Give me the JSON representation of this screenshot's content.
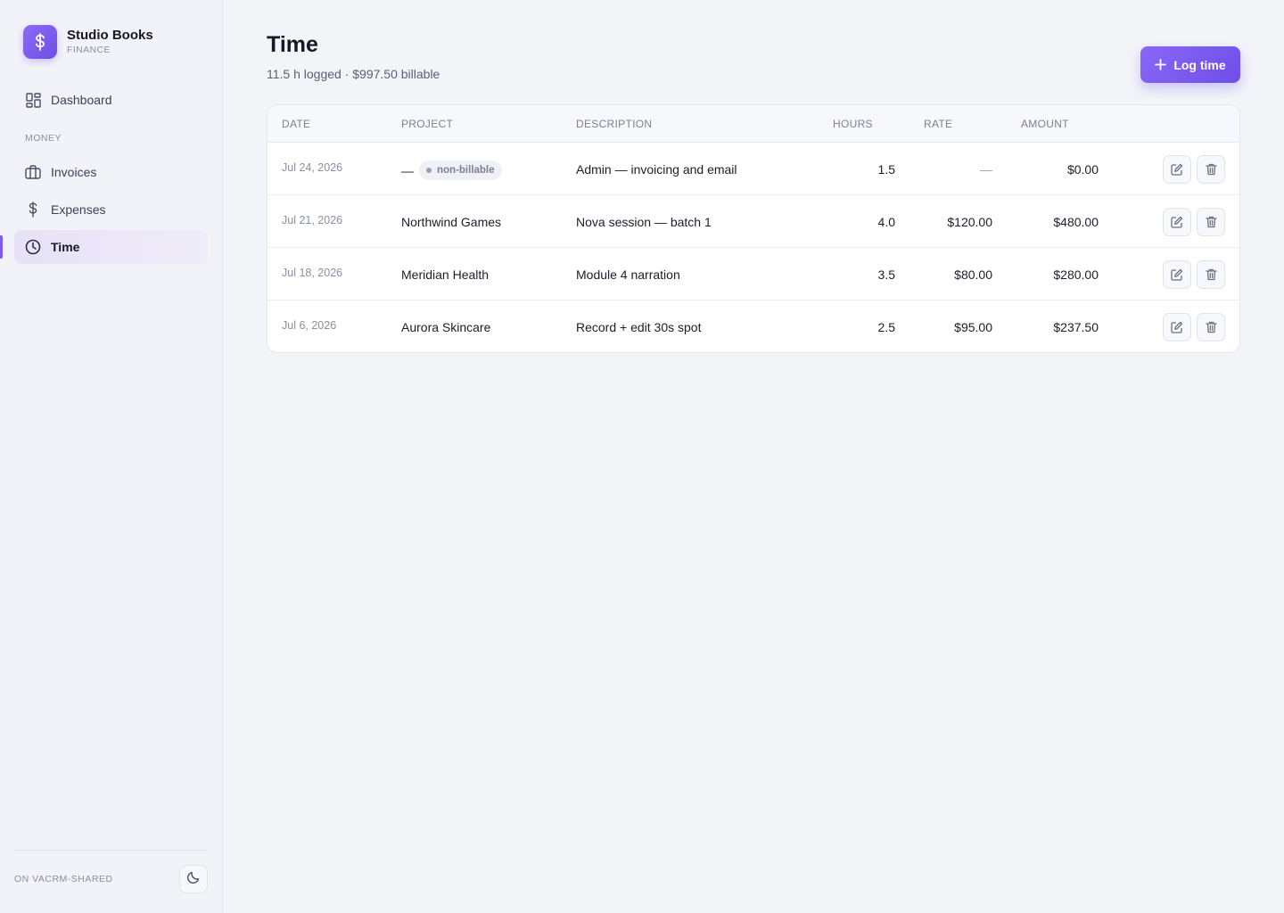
{
  "brand": {
    "name": "Studio Books",
    "subtitle": "FINANCE",
    "logo_icon": "dollar-icon",
    "accent": "#7a5af0"
  },
  "sidebar": {
    "items": [
      {
        "label": "Dashboard",
        "icon": "dashboard-icon"
      },
      {
        "label": "Invoices",
        "icon": "briefcase-icon"
      },
      {
        "label": "Expenses",
        "icon": "dollar-icon"
      },
      {
        "label": "Time",
        "icon": "clock-icon",
        "active": true
      }
    ],
    "section_money": "MONEY",
    "footer_label": "ON VACRM-SHARED",
    "theme_icon": "moon-icon"
  },
  "page": {
    "title": "Time",
    "subtitle": "11.5 h logged · $997.50 billable",
    "log_button": "Log time"
  },
  "table": {
    "headers": {
      "date": "DATE",
      "project": "PROJECT",
      "description": "DESCRIPTION",
      "hours": "HOURS",
      "rate": "RATE",
      "amount": "AMOUNT"
    },
    "rows": [
      {
        "date": "Jul 24, 2026",
        "project": "—",
        "badge": "non-billable",
        "description": "Admin — invoicing and email",
        "hours": "1.5",
        "rate": "—",
        "amount": "$0.00"
      },
      {
        "date": "Jul 21, 2026",
        "project": "Northwind Games",
        "description": "Nova session — batch 1",
        "hours": "4.0",
        "rate": "$120.00",
        "amount": "$480.00"
      },
      {
        "date": "Jul 18, 2026",
        "project": "Meridian Health",
        "description": "Module 4 narration",
        "hours": "3.5",
        "rate": "$80.00",
        "amount": "$280.00"
      },
      {
        "date": "Jul 6, 2026",
        "project": "Aurora Skincare",
        "description": "Record + edit 30s spot",
        "hours": "2.5",
        "rate": "$95.00",
        "amount": "$237.50"
      }
    ]
  }
}
